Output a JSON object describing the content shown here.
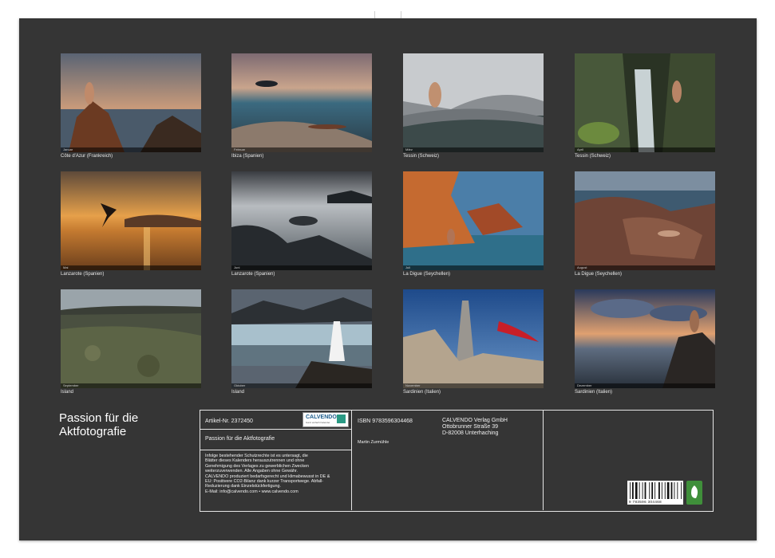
{
  "calendar": {
    "title": "Passion für die Aktfotografie",
    "months": [
      {
        "caption": "Côte d'Azur (Frankreich)",
        "strip": "Januar"
      },
      {
        "caption": "Ibiza (Spanien)",
        "strip": "Februar"
      },
      {
        "caption": "Tessin (Schweiz)",
        "strip": "März"
      },
      {
        "caption": "Tessin (Schweiz)",
        "strip": "April"
      },
      {
        "caption": "Lanzarote (Spanien)",
        "strip": "Mai"
      },
      {
        "caption": "Lanzarote (Spanien)",
        "strip": "Juni"
      },
      {
        "caption": "La Digue (Seychellen)",
        "strip": "Juli"
      },
      {
        "caption": "La Digue (Seychellen)",
        "strip": "August"
      },
      {
        "caption": "Island",
        "strip": "September"
      },
      {
        "caption": "Island",
        "strip": "Oktober"
      },
      {
        "caption": "Sardinien (Italien)",
        "strip": "November"
      },
      {
        "caption": "Sardinien (Italien)",
        "strip": "Dezember"
      }
    ]
  },
  "info": {
    "article": "Artikel-Nr. 2372450",
    "product_title": "Passion für die Aktfotografie",
    "legal_text": [
      "Infolge bestehender Schutzrechte ist es untersagt, die",
      "Blätter dieses Kalenders herauszutrennen und ohne",
      "Genehmigung des Verlages zu gewerblichen Zwecken",
      "weiterzuverwenden. Alle Angaben ohne Gewähr.",
      "CALVENDO produziert bedarfsgerecht und klimabewusst in DE &",
      "EU: Positivere CO2-Bilanz dank kurzer Transportwege. Abfall-",
      "Reduzierung dank Einzelstückfertigung.",
      "E-Mail: info@calvendo.com • www.calvendo.com"
    ],
    "isbn": "ISBN 9783596304468",
    "author": "Martin Zurmühle",
    "publisher": [
      "CALVENDO Verlag GmbH",
      "Ottobrunner Straße 39",
      "D-82008 Unterhaching"
    ],
    "logo_text": "CALVENDO",
    "logo_sub": "Ganz einfach Kalender",
    "barcode_number": "9 783596 304468"
  }
}
